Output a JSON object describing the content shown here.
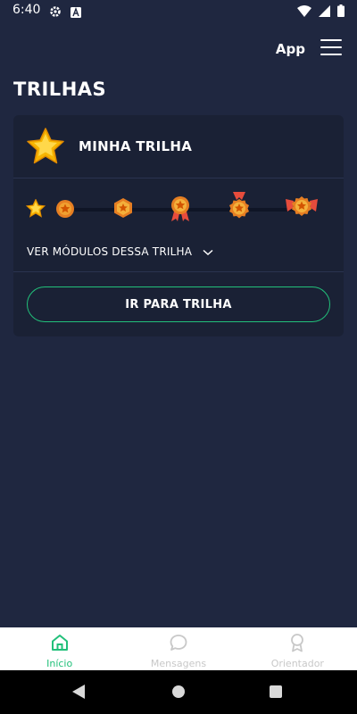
{
  "status_bar": {
    "time": "6:40"
  },
  "header": {
    "app_label": "App"
  },
  "page": {
    "title": "TRILHAS"
  },
  "trail_card": {
    "title": "MINHA TRILHA",
    "modules_toggle_label": "VER MÓDULOS DESSA TRILHA",
    "cta_label": "IR PARA TRILHA",
    "milestones": [
      "star",
      "bronze-medal",
      "silver-medal",
      "ribbon-medal",
      "gold-medal",
      "trophy-medal"
    ]
  },
  "bottom_nav": {
    "items": [
      {
        "label": "Início",
        "icon": "home-icon",
        "active": true
      },
      {
        "label": "Mensagens",
        "icon": "chat-icon",
        "active": false
      },
      {
        "label": "Orientador",
        "icon": "award-icon",
        "active": false
      }
    ]
  },
  "colors": {
    "background": "#1f2740",
    "card": "#1a2135",
    "accent": "#22c07a"
  }
}
